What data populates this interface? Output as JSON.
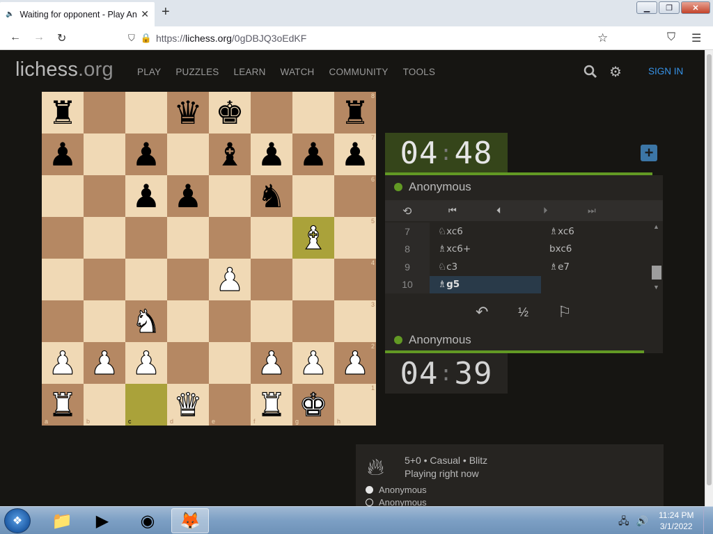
{
  "browser": {
    "tab_title": "Waiting for opponent - Play An",
    "url_prefix": "https://",
    "url_domain": "lichess.org",
    "url_path": "/0gDBJQ3oEdKF"
  },
  "site": {
    "logo_main": "lichess",
    "logo_tld": ".org",
    "nav": [
      "PLAY",
      "PUZZLES",
      "LEARN",
      "WATCH",
      "COMMUNITY",
      "TOOLS"
    ],
    "signin": "SIGN IN"
  },
  "board": {
    "ranks": [
      "8",
      "7",
      "6",
      "5",
      "4",
      "3",
      "2",
      "1"
    ],
    "files": [
      "a",
      "b",
      "c",
      "d",
      "e",
      "f",
      "g",
      "h"
    ],
    "highlight": [
      "g5",
      "c1"
    ],
    "pieces": {
      "a8": "♜b",
      "d8": "♛b",
      "e8": "♚b",
      "h8": "♜b",
      "a7": "♟b",
      "c7": "♟b",
      "e7": "♝b",
      "f7": "♟b",
      "g7": "♟b",
      "h7": "♟b",
      "c6": "♟b",
      "d6": "♟b",
      "f6": "♞b",
      "g5": "♗w",
      "e4": "♙w",
      "c3": "♘w",
      "a2": "♙w",
      "b2": "♙w",
      "c2": "♙w",
      "f2": "♙w",
      "g2": "♙w",
      "h2": "♙w",
      "a1": "♖w",
      "d1": "♕w",
      "f1": "♖w",
      "g1": "♔w"
    }
  },
  "game": {
    "top_clock_min": "04",
    "top_clock_sec": "48",
    "bottom_clock_min": "04",
    "bottom_clock_sec": "39",
    "top_player": "Anonymous",
    "bottom_player": "Anonymous",
    "moves": [
      {
        "num": "7",
        "white": "♘xc6",
        "black": "♗xc6"
      },
      {
        "num": "8",
        "white": "♗xc6+",
        "black": "bxc6"
      },
      {
        "num": "9",
        "white": "♘c3",
        "black": "♗e7"
      },
      {
        "num": "10",
        "white": "♗g5",
        "black": ""
      }
    ],
    "active_move": "10w"
  },
  "info": {
    "line1": "5+0 • Casual • Blitz",
    "line2": "Playing right now",
    "player1": "Anonymous",
    "player2": "Anonymous"
  },
  "taskbar": {
    "time": "11:24 PM",
    "date": "3/1/2022"
  }
}
